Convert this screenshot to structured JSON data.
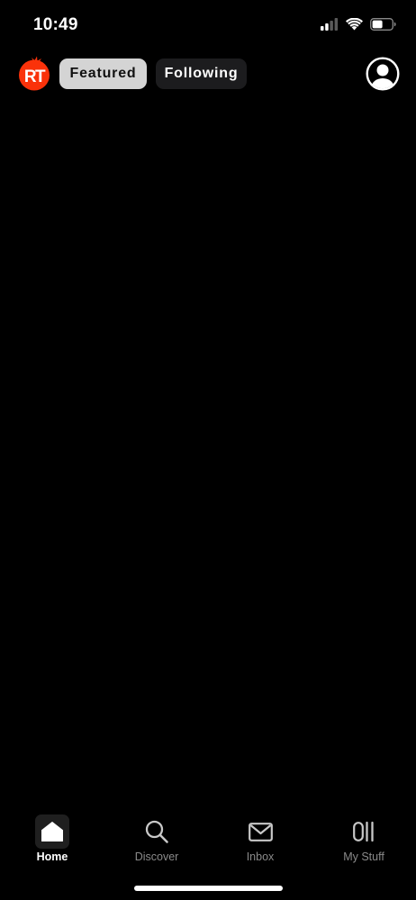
{
  "status_bar": {
    "time": "10:49"
  },
  "header": {
    "logo_icon": "rotten-tomatoes-logo",
    "tabs": [
      {
        "label": "Featured",
        "selected": true
      },
      {
        "label": "Following",
        "selected": false
      }
    ],
    "profile_icon": "user-profile-icon"
  },
  "bottom_nav": {
    "items": [
      {
        "label": "Home",
        "icon": "home-icon",
        "active": true
      },
      {
        "label": "Discover",
        "icon": "search-icon",
        "active": false
      },
      {
        "label": "Inbox",
        "icon": "mail-icon",
        "active": false
      },
      {
        "label": "My Stuff",
        "icon": "library-icon",
        "active": false
      }
    ]
  },
  "colors": {
    "background": "#000000",
    "logo_red": "#fa320a",
    "selected_tab_bg": "#d4d4d4",
    "unselected_tab_bg": "#1c1c1e",
    "inactive_label": "#8a8a8a"
  }
}
